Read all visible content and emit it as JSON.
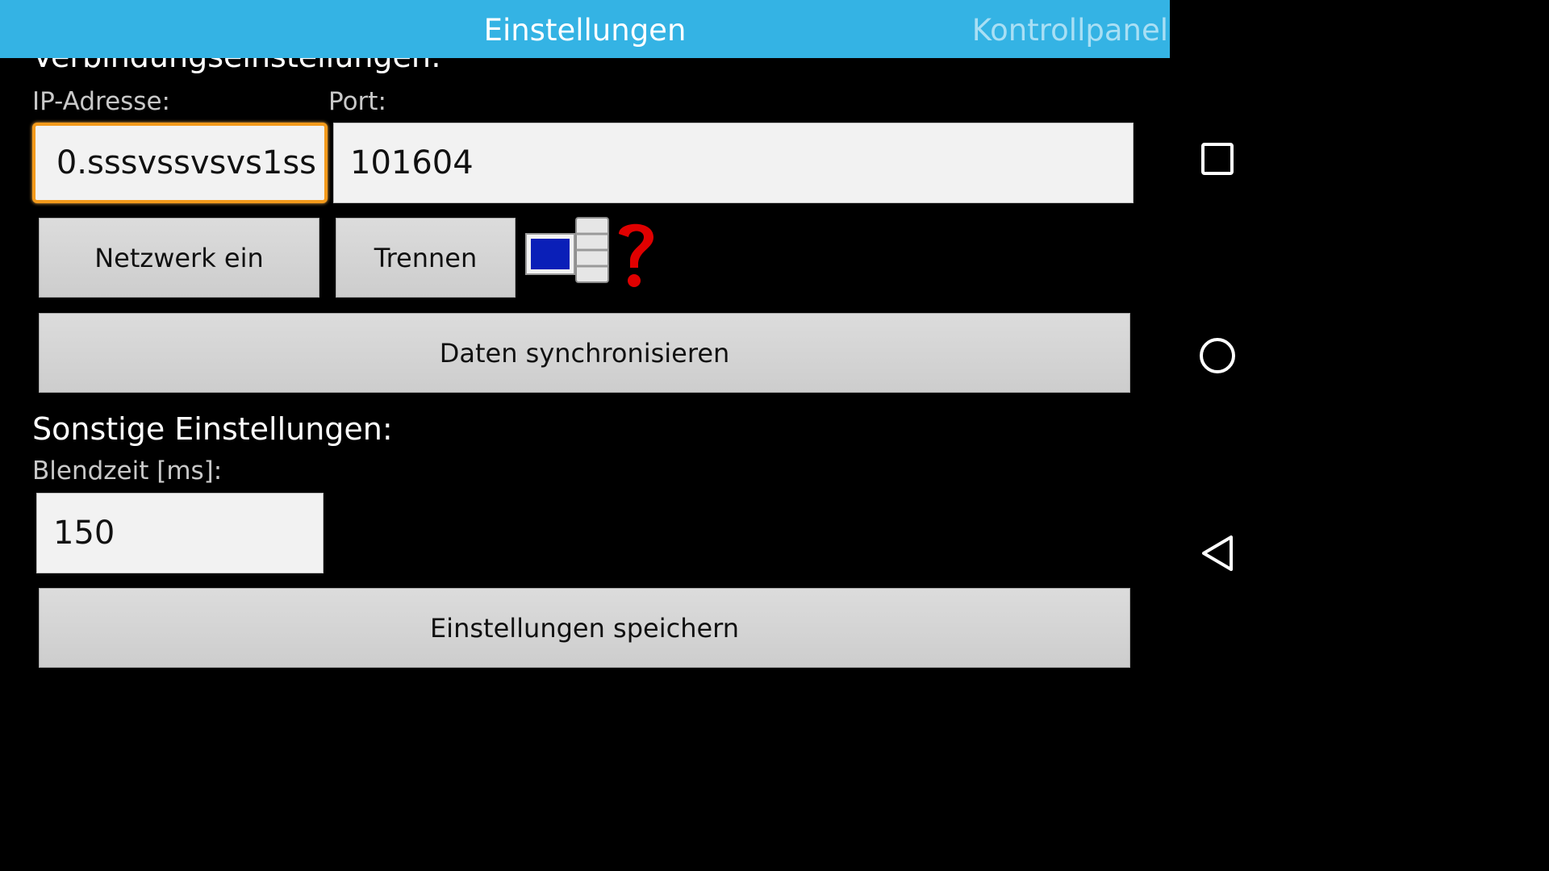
{
  "action_bar": {
    "title": "Einstellungen",
    "tab_label": "Kontrollpanel",
    "color": "#34b3e4"
  },
  "connection": {
    "section_title": "Verbindungseinstellungen:",
    "ip_label": "IP-Adresse:",
    "ip_value": "0.sssvssvsvs1ss",
    "port_label": "Port:",
    "port_value": "101604",
    "network_button": "Netzwerk ein",
    "disconnect_button": "Trennen",
    "status_icon": "network-unknown-icon",
    "sync_button": "Daten synchronisieren"
  },
  "other": {
    "section_title": "Sonstige Einstellungen:",
    "blend_label": "Blendzeit [ms]:",
    "blend_value": "150",
    "save_button": "Einstellungen speichern"
  },
  "navigation": {
    "icons": [
      "recents-icon",
      "home-icon",
      "back-icon"
    ]
  },
  "colors": {
    "focus_border": "#f39a1b",
    "status_question": "#e00000",
    "status_screen": "#0a1fb8"
  }
}
